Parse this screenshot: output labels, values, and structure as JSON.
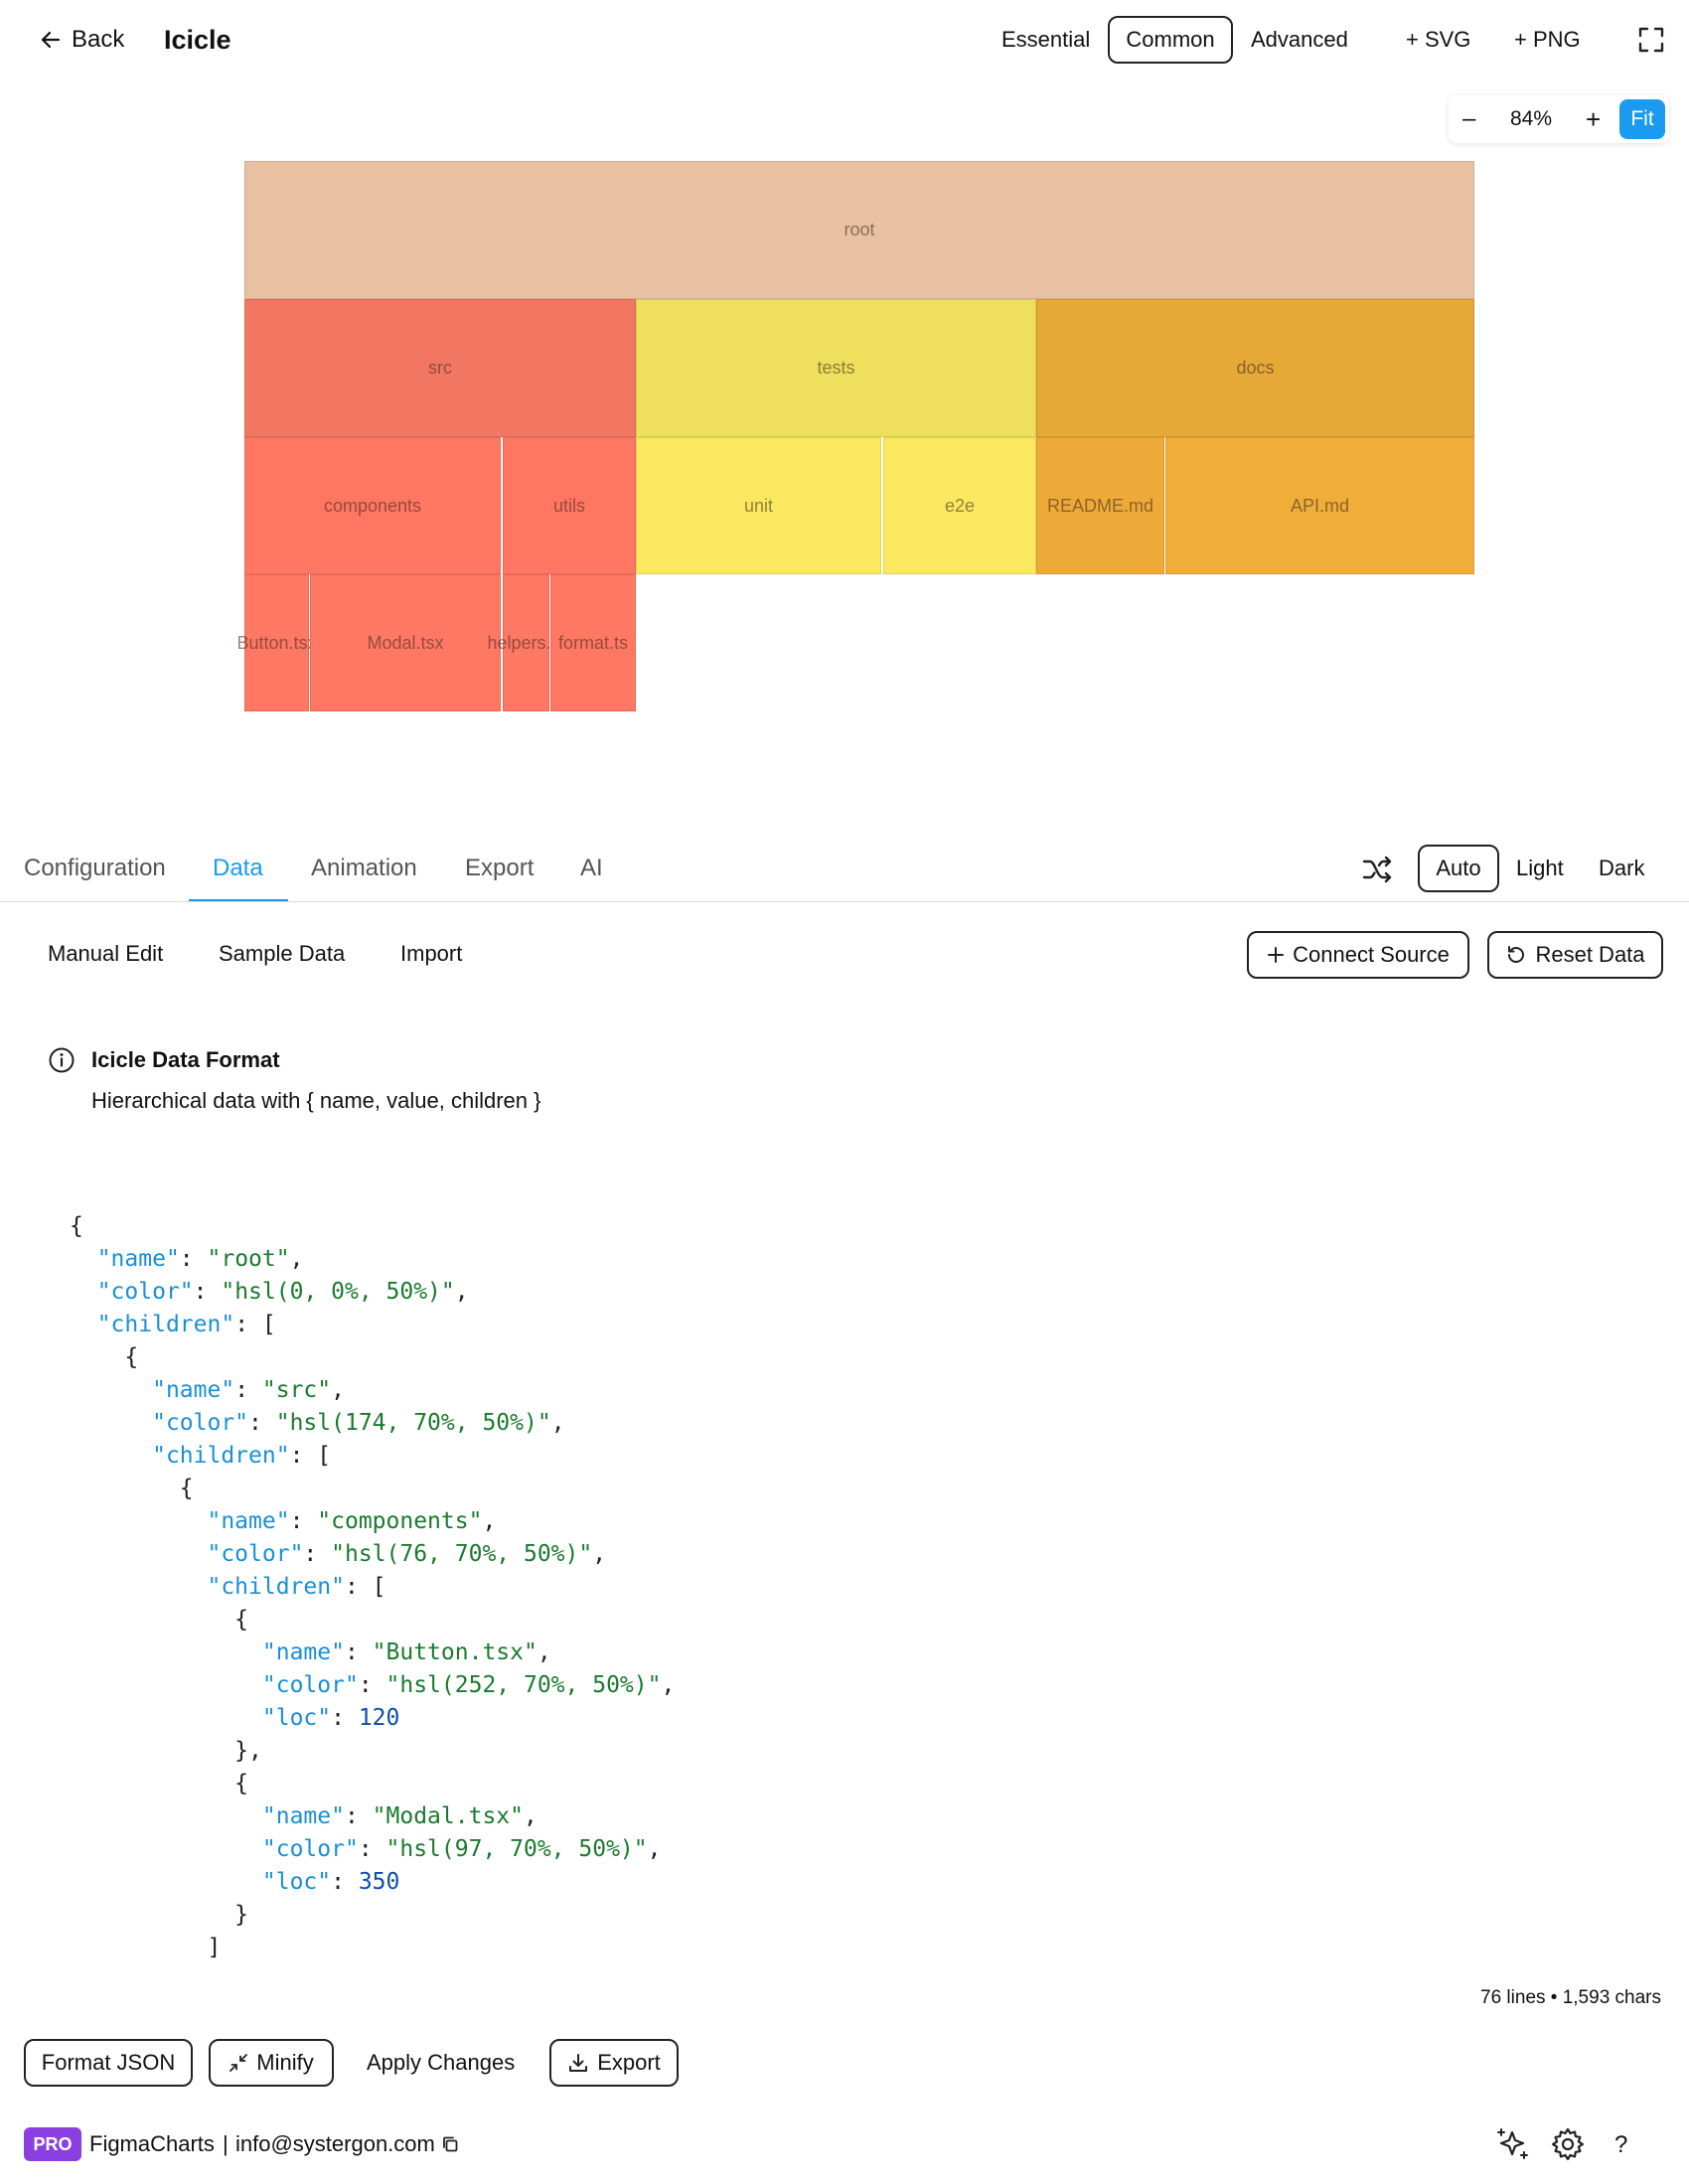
{
  "header": {
    "back_label": "Back",
    "title": "Icicle",
    "presets": [
      "Essential",
      "Common",
      "Advanced"
    ],
    "active_preset": "Common",
    "svg_label": "+ SVG",
    "png_label": "+ PNG"
  },
  "zoom": {
    "minus": "–",
    "level": "84%",
    "plus": "+",
    "fit": "Fit"
  },
  "chart_data": {
    "type": "icicle",
    "nodes": [
      {
        "name": "root",
        "depth": 0,
        "parent": null,
        "color": "#e8c1a2"
      },
      {
        "name": "src",
        "depth": 1,
        "parent": "root",
        "color": "#f27763"
      },
      {
        "name": "tests",
        "depth": 1,
        "parent": "root",
        "color": "#eee05d"
      },
      {
        "name": "docs",
        "depth": 1,
        "parent": "root",
        "color": "#e6a836"
      },
      {
        "name": "components",
        "depth": 2,
        "parent": "src",
        "color": "#ff7762"
      },
      {
        "name": "utils",
        "depth": 2,
        "parent": "src",
        "color": "#ff7762"
      },
      {
        "name": "unit",
        "depth": 2,
        "parent": "tests",
        "color": "#fae861"
      },
      {
        "name": "e2e",
        "depth": 2,
        "parent": "tests",
        "color": "#fae861"
      },
      {
        "name": "README.md",
        "depth": 2,
        "parent": "docs",
        "color": "#eeaa38"
      },
      {
        "name": "API.md",
        "depth": 2,
        "parent": "docs",
        "color": "#f0ad3a"
      },
      {
        "name": "Button.tsx",
        "depth": 3,
        "parent": "components",
        "color": "#ff7864"
      },
      {
        "name": "Modal.tsx",
        "depth": 3,
        "parent": "components",
        "color": "#ff7864"
      },
      {
        "name": "helpers.ts",
        "depth": 3,
        "parent": "utils",
        "color": "#ff7864"
      },
      {
        "name": "format.ts",
        "depth": 3,
        "parent": "utils",
        "color": "#ff7864"
      }
    ]
  },
  "tabs": {
    "items": [
      "Configuration",
      "Data",
      "Animation",
      "Export",
      "AI"
    ],
    "active": "Data",
    "theme_options": [
      "Auto",
      "Light",
      "Dark"
    ],
    "active_theme": "Auto"
  },
  "data_panel": {
    "subtabs": [
      "Manual Edit",
      "Sample Data",
      "Import"
    ],
    "connect_label": "Connect Source",
    "reset_label": "Reset Data",
    "info_title": "Icicle Data Format",
    "info_desc": "Hierarchical data with { name, value, children }",
    "stats": "76 lines • 1,593 chars",
    "format_label": "Format JSON",
    "minify_label": "Minify",
    "apply_label": "Apply Changes",
    "export_label": "Export"
  },
  "code_lines": [
    [
      [
        "p",
        "{"
      ]
    ],
    [
      [
        "p",
        "  "
      ],
      [
        "k",
        "\"name\""
      ],
      [
        "p",
        ": "
      ],
      [
        "s",
        "\"root\""
      ],
      [
        "p",
        ","
      ]
    ],
    [
      [
        "p",
        "  "
      ],
      [
        "k",
        "\"color\""
      ],
      [
        "p",
        ": "
      ],
      [
        "s",
        "\"hsl(0, 0%, 50%)\""
      ],
      [
        "p",
        ","
      ]
    ],
    [
      [
        "p",
        "  "
      ],
      [
        "k",
        "\"children\""
      ],
      [
        "p",
        ": ["
      ]
    ],
    [
      [
        "p",
        "    {"
      ]
    ],
    [
      [
        "p",
        "      "
      ],
      [
        "k",
        "\"name\""
      ],
      [
        "p",
        ": "
      ],
      [
        "s",
        "\"src\""
      ],
      [
        "p",
        ","
      ]
    ],
    [
      [
        "p",
        "      "
      ],
      [
        "k",
        "\"color\""
      ],
      [
        "p",
        ": "
      ],
      [
        "s",
        "\"hsl(174, 70%, 50%)\""
      ],
      [
        "p",
        ","
      ]
    ],
    [
      [
        "p",
        "      "
      ],
      [
        "k",
        "\"children\""
      ],
      [
        "p",
        ": ["
      ]
    ],
    [
      [
        "p",
        "        {"
      ]
    ],
    [
      [
        "p",
        "          "
      ],
      [
        "k",
        "\"name\""
      ],
      [
        "p",
        ": "
      ],
      [
        "s",
        "\"components\""
      ],
      [
        "p",
        ","
      ]
    ],
    [
      [
        "p",
        "          "
      ],
      [
        "k",
        "\"color\""
      ],
      [
        "p",
        ": "
      ],
      [
        "s",
        "\"hsl(76, 70%, 50%)\""
      ],
      [
        "p",
        ","
      ]
    ],
    [
      [
        "p",
        "          "
      ],
      [
        "k",
        "\"children\""
      ],
      [
        "p",
        ": ["
      ]
    ],
    [
      [
        "p",
        "            {"
      ]
    ],
    [
      [
        "p",
        "              "
      ],
      [
        "k",
        "\"name\""
      ],
      [
        "p",
        ": "
      ],
      [
        "s",
        "\"Button.tsx\""
      ],
      [
        "p",
        ","
      ]
    ],
    [
      [
        "p",
        "              "
      ],
      [
        "k",
        "\"color\""
      ],
      [
        "p",
        ": "
      ],
      [
        "s",
        "\"hsl(252, 70%, 50%)\""
      ],
      [
        "p",
        ","
      ]
    ],
    [
      [
        "p",
        "              "
      ],
      [
        "k",
        "\"loc\""
      ],
      [
        "p",
        ": "
      ],
      [
        "n",
        "120"
      ]
    ],
    [
      [
        "p",
        "            },"
      ]
    ],
    [
      [
        "p",
        "            {"
      ]
    ],
    [
      [
        "p",
        "              "
      ],
      [
        "k",
        "\"name\""
      ],
      [
        "p",
        ": "
      ],
      [
        "s",
        "\"Modal.tsx\""
      ],
      [
        "p",
        ","
      ]
    ],
    [
      [
        "p",
        "              "
      ],
      [
        "k",
        "\"color\""
      ],
      [
        "p",
        ": "
      ],
      [
        "s",
        "\"hsl(97, 70%, 50%)\""
      ],
      [
        "p",
        ","
      ]
    ],
    [
      [
        "p",
        "              "
      ],
      [
        "k",
        "\"loc\""
      ],
      [
        "p",
        ": "
      ],
      [
        "n",
        "350"
      ]
    ],
    [
      [
        "p",
        "            }"
      ]
    ],
    [
      [
        "p",
        "          ]"
      ]
    ]
  ],
  "footer": {
    "badge": "PRO",
    "brand": "FigmaCharts",
    "separator": "|",
    "email": "info@systergon.com",
    "help": "?"
  },
  "colors": {
    "accent": "#1a9bf0",
    "pro_badge": "#8b3fe0",
    "json_key": "#1a8fd6",
    "json_string": "#1b7a2f",
    "json_number": "#0b4fa8"
  }
}
